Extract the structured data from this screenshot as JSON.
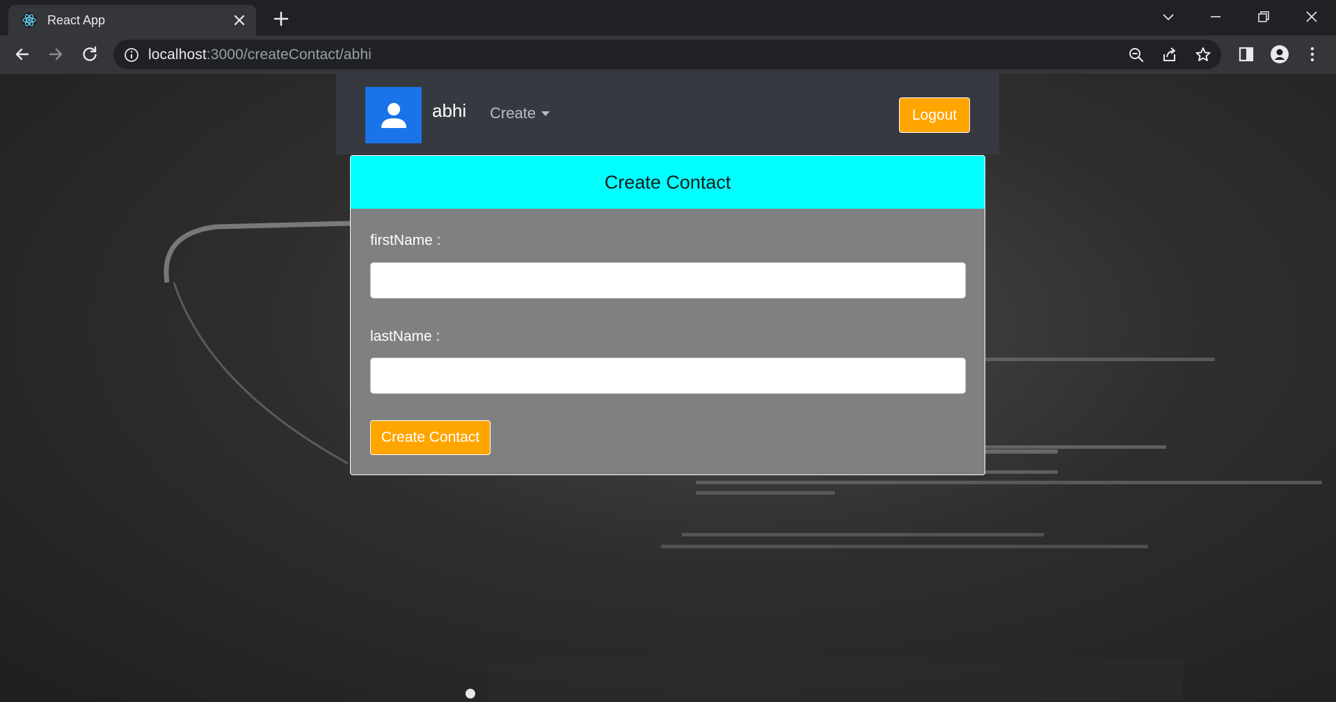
{
  "browser": {
    "tab": {
      "title": "React App",
      "favicon": "react-logo-icon"
    },
    "url": {
      "host": "localhost",
      "path": ":3000/createContact/abhi"
    }
  },
  "navbar": {
    "avatar_icon": "user-icon",
    "username": "abhi",
    "create_menu": "Create",
    "logout": "Logout"
  },
  "form": {
    "title": "Create Contact",
    "first_name_label": "firstName :",
    "first_name_value": "",
    "last_name_label": "lastName :",
    "last_name_value": "",
    "submit": "Create Contact"
  },
  "colors": {
    "header_accent": "#00ffff",
    "button_accent": "#ffa500",
    "avatar_bg": "#1a73e8",
    "card_bg": "#808080"
  }
}
